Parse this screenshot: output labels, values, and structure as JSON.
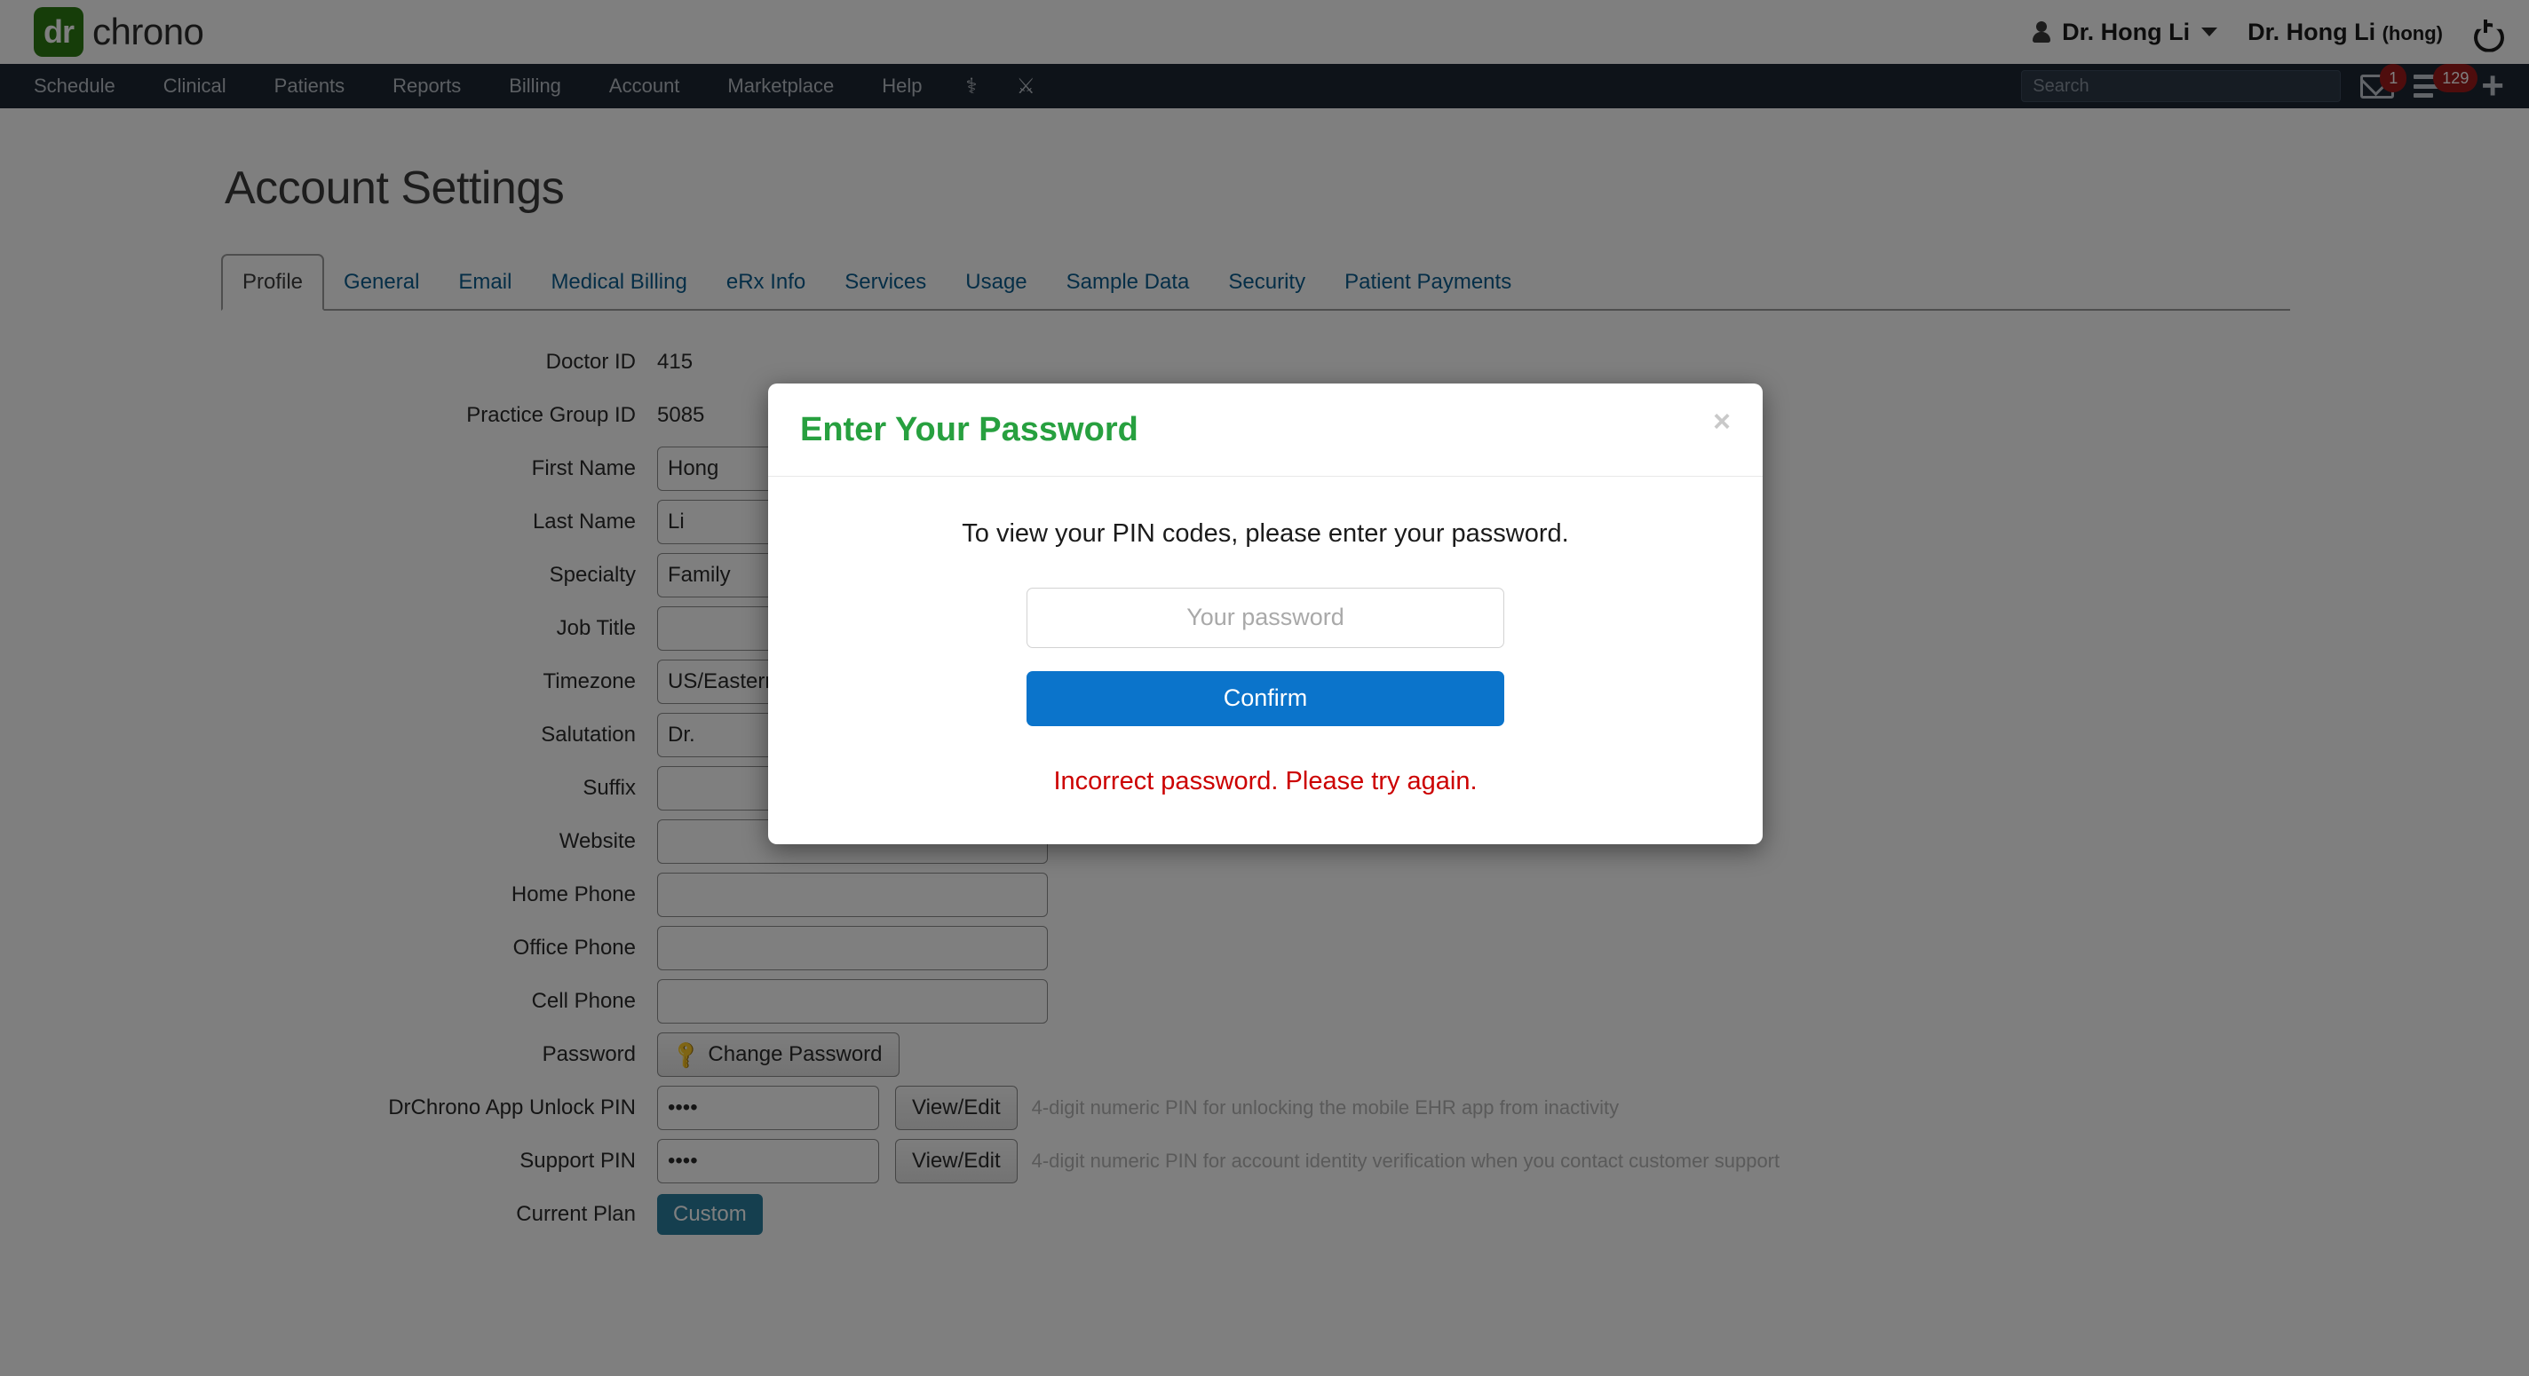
{
  "brand": {
    "logo_badge": "dr",
    "logo_text": "chrono",
    "logo_color": "#2d7b12"
  },
  "topbar": {
    "user_menu_label": "Dr. Hong Li",
    "user_full_name": "Dr. Hong Li",
    "user_username": "(hong)",
    "person_icon": "person-icon",
    "caret_icon": "chevron-down-icon",
    "power_icon": "power-icon"
  },
  "nav": {
    "items": [
      {
        "label": "Schedule"
      },
      {
        "label": "Clinical"
      },
      {
        "label": "Patients"
      },
      {
        "label": "Reports"
      },
      {
        "label": "Billing"
      },
      {
        "label": "Account"
      },
      {
        "label": "Marketplace"
      },
      {
        "label": "Help"
      }
    ],
    "icons": [
      {
        "name": "caduceus-icon",
        "glyph": "⚕"
      },
      {
        "name": "crossed-swords-icon",
        "glyph": "⚔"
      }
    ],
    "search_placeholder": "Search",
    "search_value": "",
    "messages_count": "1",
    "tasks_count": "129",
    "add_icon": "+",
    "bar_color": "#1d2733",
    "badge_color": "#9e1b1b"
  },
  "page": {
    "title": "Account Settings"
  },
  "tabs": [
    {
      "label": "Profile",
      "active": true
    },
    {
      "label": "General",
      "active": false
    },
    {
      "label": "Email",
      "active": false
    },
    {
      "label": "Medical Billing",
      "active": false
    },
    {
      "label": "eRx Info",
      "active": false
    },
    {
      "label": "Services",
      "active": false
    },
    {
      "label": "Usage",
      "active": false
    },
    {
      "label": "Sample Data",
      "active": false
    },
    {
      "label": "Security",
      "active": false
    },
    {
      "label": "Patient Payments",
      "active": false
    }
  ],
  "form": {
    "doctor_id_label": "Doctor ID",
    "doctor_id_value": "415",
    "practice_group_id_label": "Practice Group ID",
    "practice_group_id_value": "5085",
    "first_name_label": "First Name",
    "first_name_value": "Hong",
    "last_name_label": "Last Name",
    "last_name_value": "Li",
    "specialty_label": "Specialty",
    "specialty_value": "Family",
    "job_title_label": "Job Title",
    "job_title_value": "",
    "timezone_label": "Timezone",
    "timezone_value": "US/Eastern",
    "salutation_label": "Salutation",
    "salutation_value": "Dr.",
    "suffix_label": "Suffix",
    "suffix_value": "",
    "website_label": "Website",
    "website_value": "",
    "home_phone_label": "Home Phone",
    "home_phone_value": "",
    "office_phone_label": "Office Phone",
    "office_phone_value": "",
    "cell_phone_label": "Cell Phone",
    "cell_phone_value": "",
    "password_label": "Password",
    "change_password_button": "Change Password",
    "key_icon": "key-icon",
    "app_unlock_pin_label": "DrChrono App Unlock PIN",
    "app_unlock_pin_value": "••••",
    "app_unlock_pin_hint": "4-digit numeric PIN for unlocking the mobile EHR app from inactivity",
    "support_pin_label": "Support PIN",
    "support_pin_value": "••••",
    "support_pin_hint": "4-digit numeric PIN for account identity verification when you contact customer support",
    "view_edit_button": "View/Edit",
    "current_plan_label": "Current Plan",
    "current_plan_value": "Custom",
    "plan_badge_color": "#2a7f9e"
  },
  "modal": {
    "title": "Enter Your Password",
    "title_color": "#27a03f",
    "close_glyph": "×",
    "body_text": "To view your PIN codes, please enter your password.",
    "input_placeholder": "Your password",
    "input_value": "",
    "confirm_label": "Confirm",
    "confirm_color": "#0b74cb",
    "error_text": "Incorrect password. Please try again.",
    "error_color": "#cc0000"
  }
}
